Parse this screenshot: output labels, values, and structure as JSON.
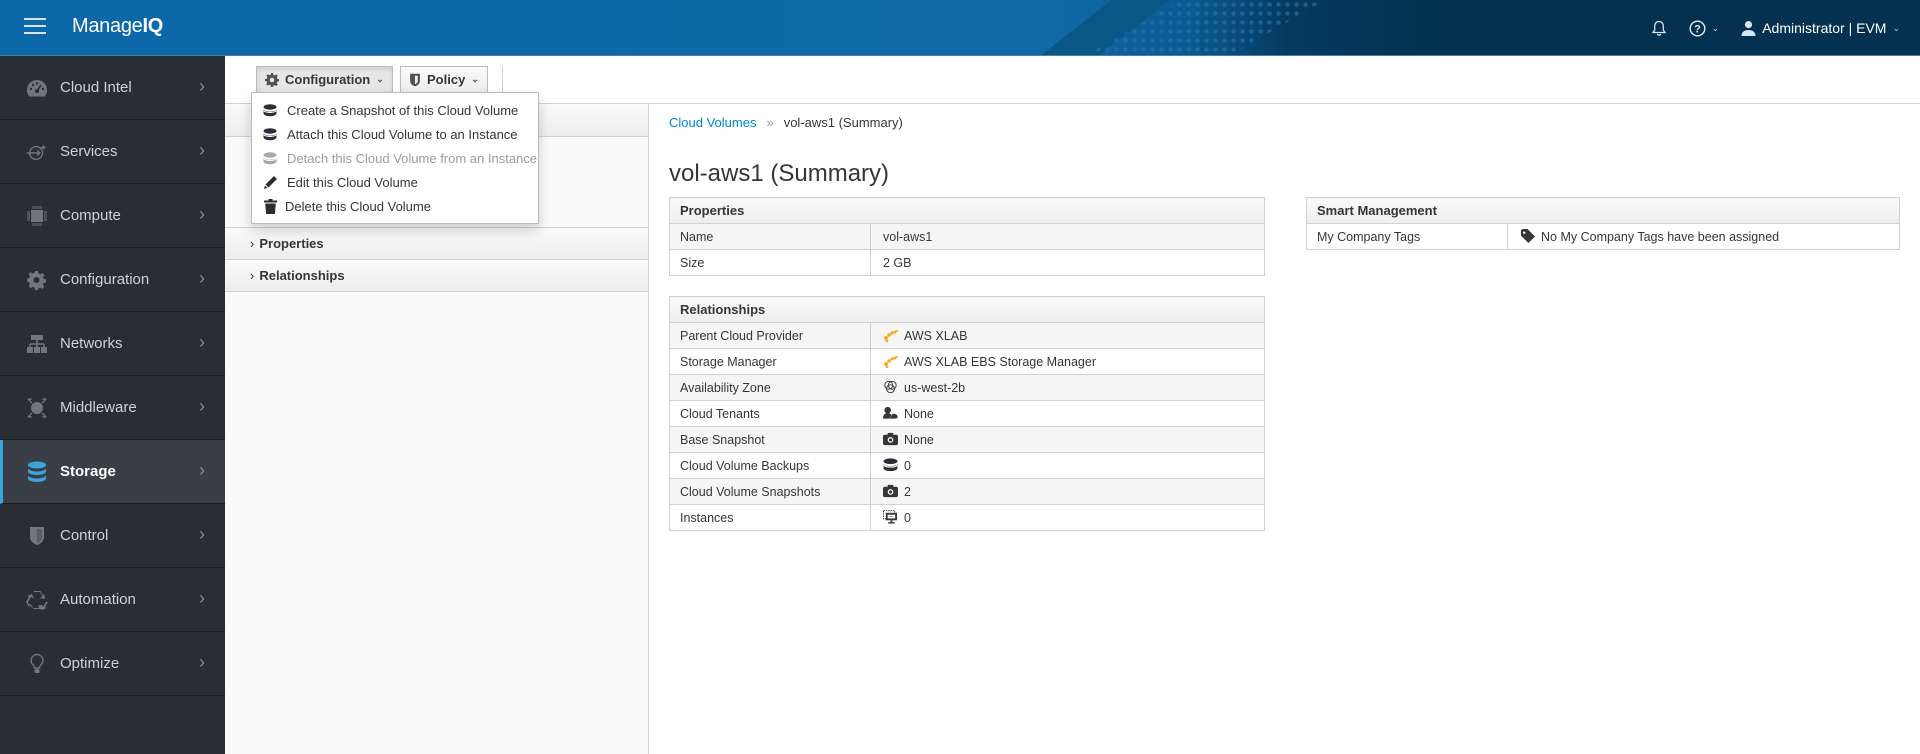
{
  "header": {
    "brand_light": "Manage",
    "brand_bold": "IQ",
    "user_label": "Administrator | EVM"
  },
  "sidebar": {
    "items": [
      {
        "label": "Cloud Intel",
        "icon": "dashboard-icon"
      },
      {
        "label": "Services",
        "icon": "services-icon"
      },
      {
        "label": "Compute",
        "icon": "cpu-icon"
      },
      {
        "label": "Configuration",
        "icon": "gear-icon"
      },
      {
        "label": "Networks",
        "icon": "network-icon"
      },
      {
        "label": "Middleware",
        "icon": "middleware-icon"
      },
      {
        "label": "Storage",
        "icon": "database-icon",
        "active": true
      },
      {
        "label": "Control",
        "icon": "shield-icon"
      },
      {
        "label": "Automation",
        "icon": "recycle-icon"
      },
      {
        "label": "Optimize",
        "icon": "lightbulb-icon"
      }
    ]
  },
  "toolbar": {
    "configuration_label": "Configuration",
    "policy_label": "Policy"
  },
  "config_menu": {
    "items": [
      {
        "label": "Create a Snapshot of this Cloud Volume",
        "icon": "database-icon",
        "disabled": false
      },
      {
        "label": "Attach this Cloud Volume to an Instance",
        "icon": "database-icon",
        "disabled": false
      },
      {
        "label": "Detach this Cloud Volume from an Instance",
        "icon": "database-icon",
        "disabled": true
      },
      {
        "label": "Edit this Cloud Volume",
        "icon": "pencil-icon",
        "disabled": false
      },
      {
        "label": "Delete this Cloud Volume",
        "icon": "trash-icon",
        "disabled": false
      }
    ]
  },
  "accordion": {
    "items": [
      {
        "label": "Properties"
      },
      {
        "label": "Relationships"
      }
    ]
  },
  "breadcrumb": {
    "parent": "Cloud Volumes",
    "separator": "»",
    "current": "vol-aws1 (Summary)"
  },
  "page_title": "vol-aws1 (Summary)",
  "properties": {
    "title": "Properties",
    "rows": [
      {
        "label": "Name",
        "value": "vol-aws1"
      },
      {
        "label": "Size",
        "value": "2 GB"
      }
    ]
  },
  "relationships": {
    "title": "Relationships",
    "rows": [
      {
        "label": "Parent Cloud Provider",
        "value": "AWS XLAB",
        "icon": "aws-icon"
      },
      {
        "label": "Storage Manager",
        "value": "AWS XLAB EBS Storage Manager",
        "icon": "aws-icon"
      },
      {
        "label": "Availability Zone",
        "value": "us-west-2b",
        "icon": "zone-icon"
      },
      {
        "label": "Cloud Tenants",
        "value": "None",
        "icon": "tenant-icon"
      },
      {
        "label": "Base Snapshot",
        "value": "None",
        "icon": "camera-icon"
      },
      {
        "label": "Cloud Volume Backups",
        "value": "0",
        "icon": "database-icon"
      },
      {
        "label": "Cloud Volume Snapshots",
        "value": "2",
        "icon": "camera-icon"
      },
      {
        "label": "Instances",
        "value": "0",
        "icon": "instance-icon"
      }
    ]
  },
  "smart_management": {
    "title": "Smart Management",
    "rows": [
      {
        "label": "My Company Tags",
        "value": "No My Company Tags have been assigned",
        "icon": "tag-icon"
      }
    ]
  },
  "colors": {
    "accent": "#39a5dc",
    "link": "#0088ce",
    "sidebar_bg": "#292e34",
    "header_blue": "#0c68a8",
    "header_dark": "#03314f"
  }
}
